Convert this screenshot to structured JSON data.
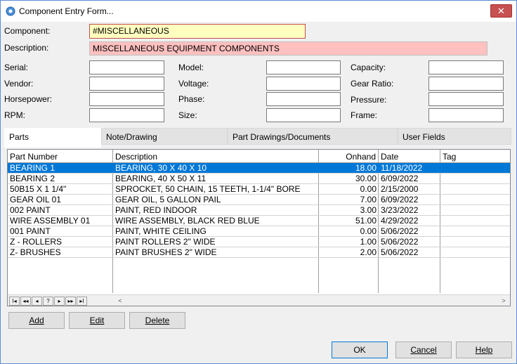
{
  "window": {
    "title": "Component Entry Form...",
    "close_label": "✕"
  },
  "fields": {
    "component_label": "Component:",
    "component_value": "#MISCELLANEOUS",
    "description_label": "Description:",
    "description_value": "MISCELLANEOUS EQUIPMENT COMPONENTS",
    "serial_label": "Serial:",
    "vendor_label": "Vendor:",
    "horsepower_label": "Horsepower:",
    "rpm_label": "RPM:",
    "model_label": "Model:",
    "voltage_label": "Voltage:",
    "phase_label": "Phase:",
    "size_label": "Size:",
    "capacity_label": "Capacity:",
    "gear_ratio_label": "Gear Ratio:",
    "pressure_label": "Pressure:",
    "frame_label": "Frame:"
  },
  "tabs": [
    "Parts",
    "Note/Drawing",
    "Part Drawings/Documents",
    "User Fields"
  ],
  "grid": {
    "columns": [
      "Part Number",
      "Description",
      "Onhand",
      "Date",
      "Tag"
    ],
    "rows": [
      {
        "part": "BEARING 1",
        "desc": "BEARING, 30 X 40 X 10",
        "onhand": "18.00",
        "date": "11/18/2022",
        "tag": ""
      },
      {
        "part": "BEARING 2",
        "desc": "BEARING, 40 X 50 X 11",
        "onhand": "30.00",
        "date": "6/09/2022",
        "tag": ""
      },
      {
        "part": "50B15 X 1 1/4\"",
        "desc": "SPROCKET, 50 CHAIN, 15 TEETH, 1-1/4\" BORE",
        "onhand": "0.00",
        "date": "2/15/2000",
        "tag": ""
      },
      {
        "part": "GEAR OIL 01",
        "desc": "GEAR OIL,  5 GALLON PAIL",
        "onhand": "7.00",
        "date": "6/09/2022",
        "tag": ""
      },
      {
        "part": "002 PAINT",
        "desc": "PAINT, RED INDOOR",
        "onhand": "3.00",
        "date": "3/23/2022",
        "tag": ""
      },
      {
        "part": "WIRE ASSEMBLY 01",
        "desc": "WIRE ASSEMBLY, BLACK RED BLUE",
        "onhand": "51.00",
        "date": "4/29/2022",
        "tag": ""
      },
      {
        "part": "001 PAINT",
        "desc": "PAINT, WHITE CEILING",
        "onhand": "0.00",
        "date": "5/06/2022",
        "tag": ""
      },
      {
        "part": "Z - ROLLERS",
        "desc": "PAINT ROLLERS 2\" WIDE",
        "onhand": "1.00",
        "date": "5/06/2022",
        "tag": ""
      },
      {
        "part": "Z- BRUSHES",
        "desc": "PAINT BRUSHES 2\" WIDE",
        "onhand": "2.00",
        "date": "5/06/2022",
        "tag": ""
      }
    ],
    "nav_buttons": [
      "I◂",
      "◂◂",
      "◂",
      "?",
      "▸",
      "▸▸",
      "▸I"
    ]
  },
  "buttons": {
    "add": "Add",
    "edit": "Edit",
    "delete": "Delete",
    "ok": "OK",
    "cancel": "Cancel",
    "help": "Help"
  },
  "colors": {
    "selection": "#0078d7",
    "component_bg": "#ffffc0",
    "description_bg": "#ffc0c0"
  }
}
